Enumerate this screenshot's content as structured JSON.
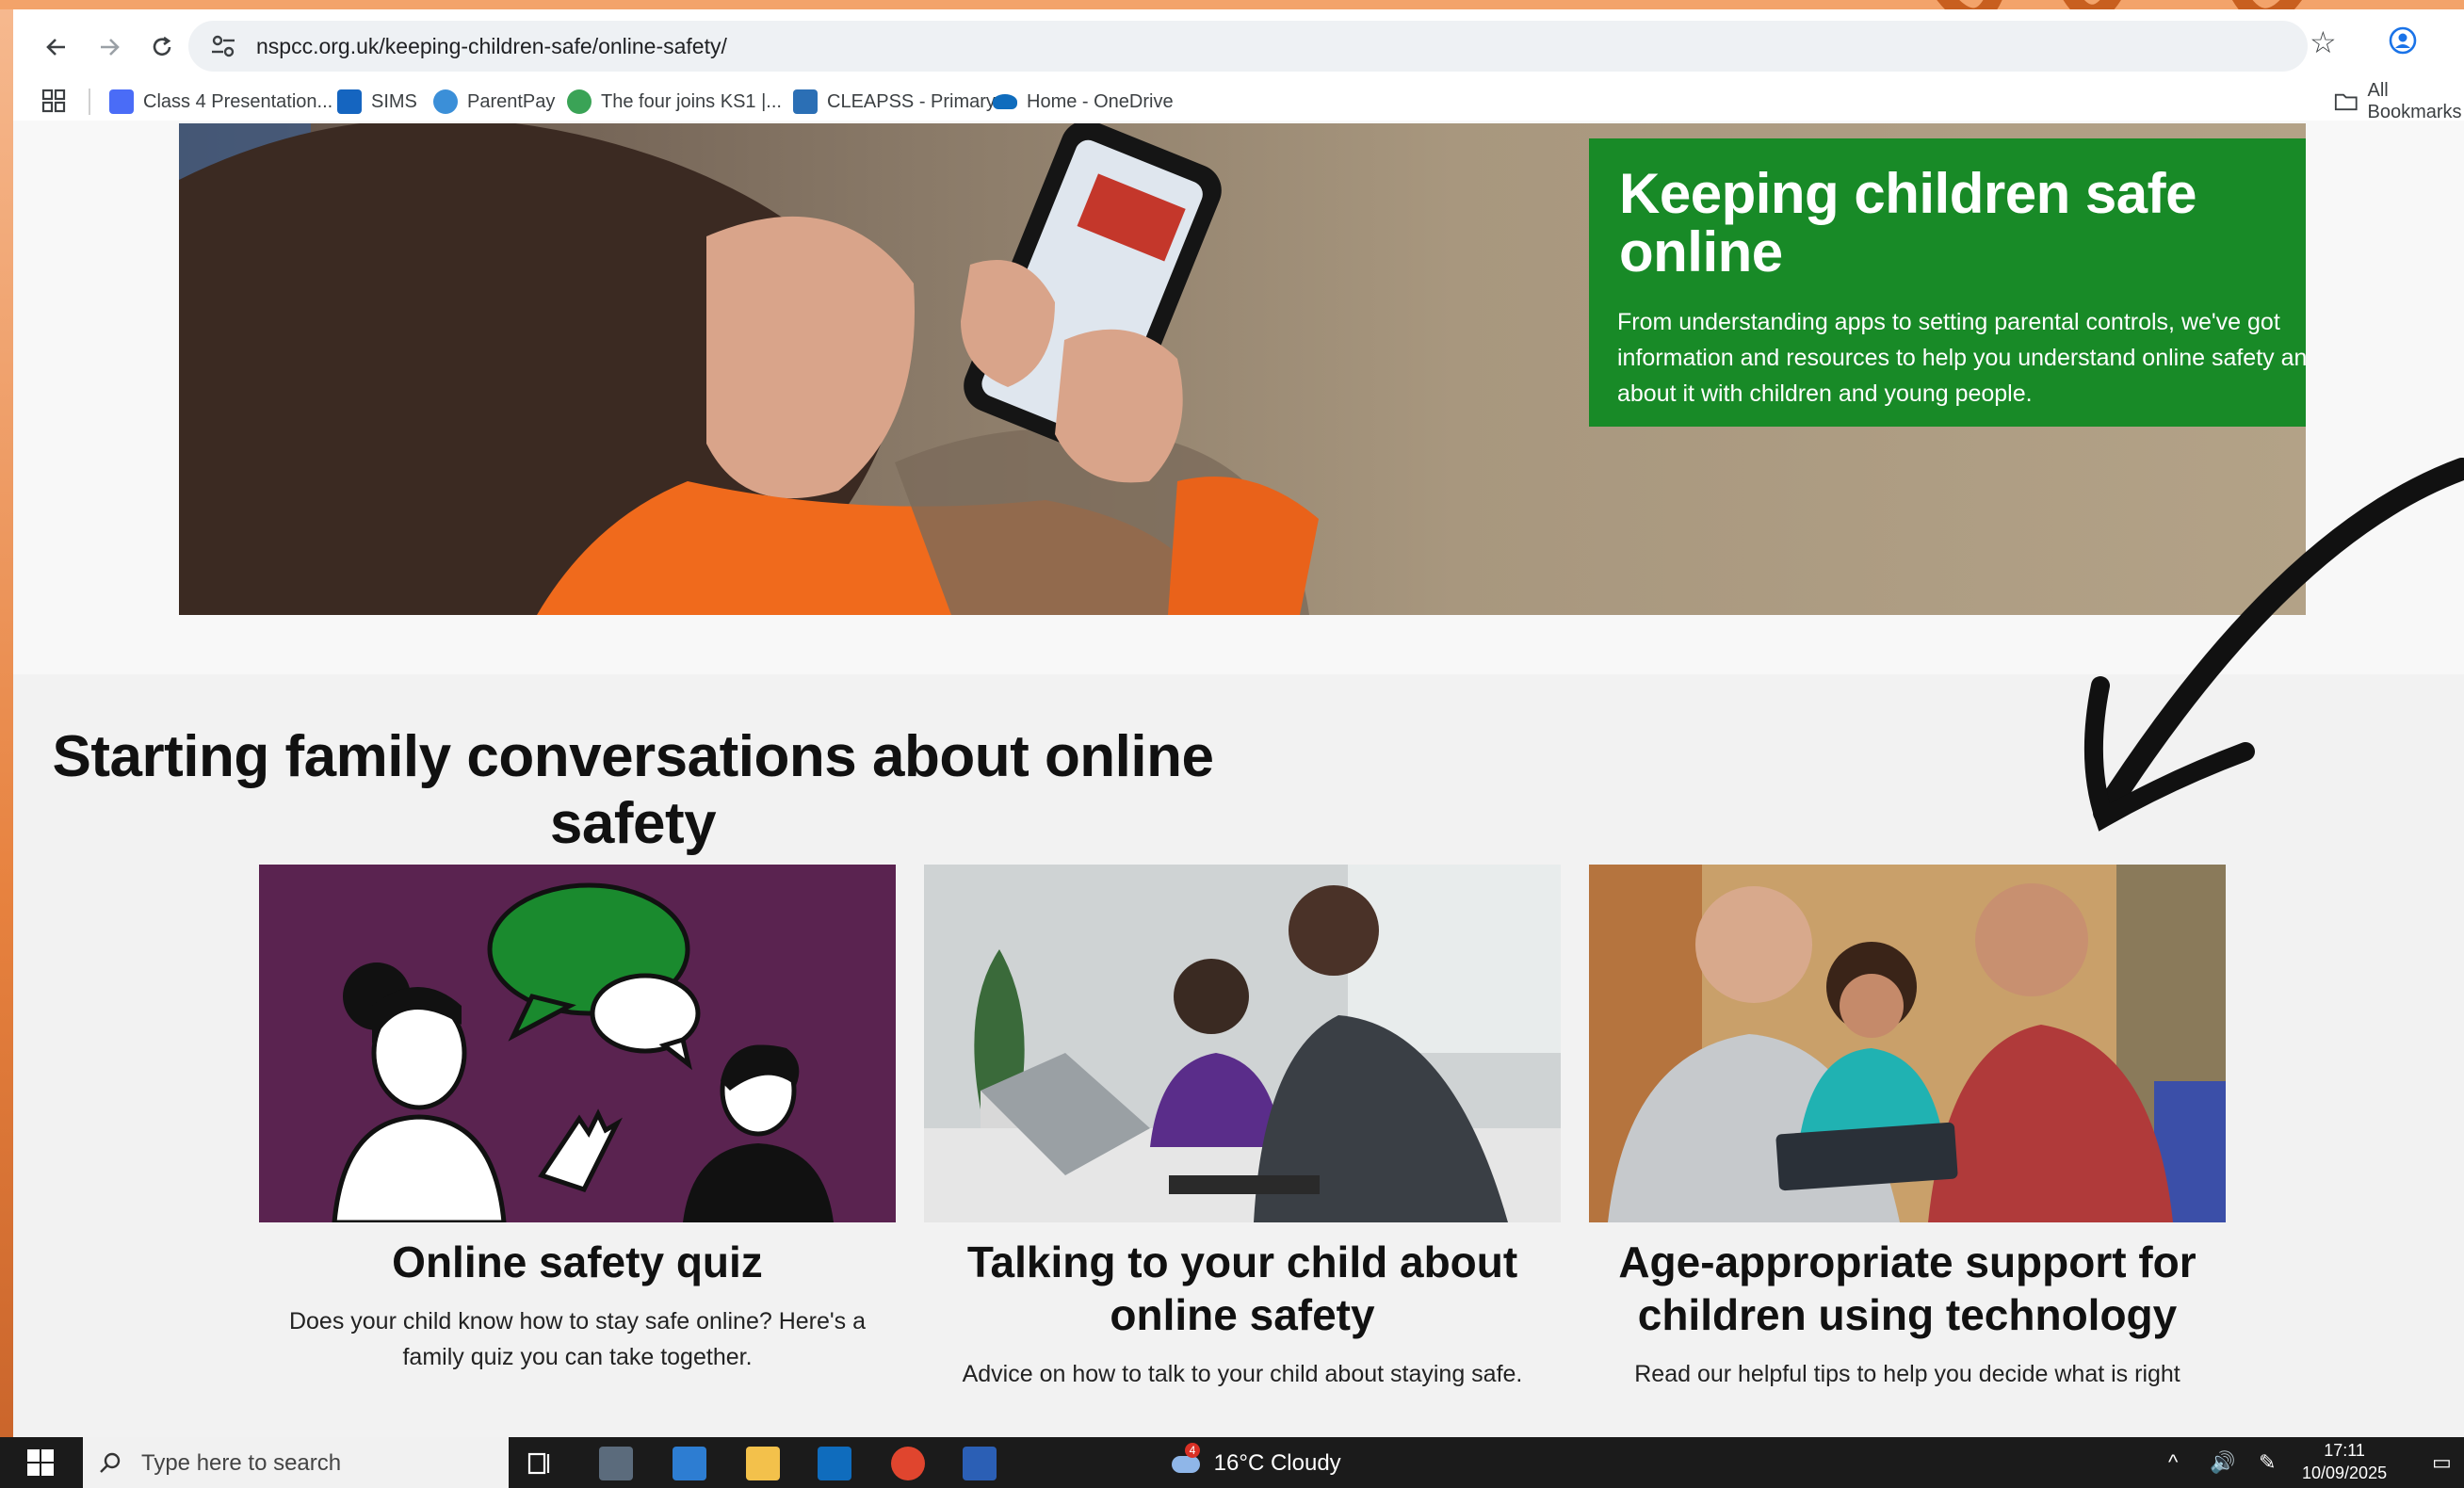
{
  "browser": {
    "url": "nspcc.org.uk/keeping-children-safe/online-safety/",
    "bookmarks": [
      {
        "label": "Class 4 Presentation...",
        "color": "#4a6cf7"
      },
      {
        "label": "SIMS",
        "color": "#1565c0"
      },
      {
        "label": "ParentPay",
        "color": "#3b8fd8"
      },
      {
        "label": "The four joins KS1 |...",
        "color": "#3aa356"
      },
      {
        "label": "CLEAPSS - Primary",
        "color": "#2b6fb5"
      },
      {
        "label": "Home - OneDrive",
        "color": "#0f6cbd"
      }
    ],
    "all_bookmarks": "All Bookmarks"
  },
  "hero": {
    "title": "Keeping children safe online",
    "text": "From understanding apps to setting parental controls, we've got information and resources to help you understand online safety and talk about it with children and young people."
  },
  "section": {
    "title": "Starting family conversations about online safety"
  },
  "cards": [
    {
      "title": "Online safety quiz",
      "text": "Does your child know how to stay safe online? Here's a family quiz you can take together."
    },
    {
      "title": "Talking to your child about online safety",
      "text": "Advice on how to talk to your child about staying safe."
    },
    {
      "title": "Age-appropriate support for children using technology",
      "text": "Read our helpful tips to help you decide what is right"
    }
  ],
  "taskbar": {
    "search_placeholder": "Type here to search",
    "weather": "16°C  Cloudy",
    "weather_badge": "4",
    "time": "17:11",
    "date": "10/09/2025"
  },
  "colors": {
    "nspcc_green": "#188a27",
    "quiz_purple": "#5a2350",
    "frame_orange": "#e7823f"
  }
}
